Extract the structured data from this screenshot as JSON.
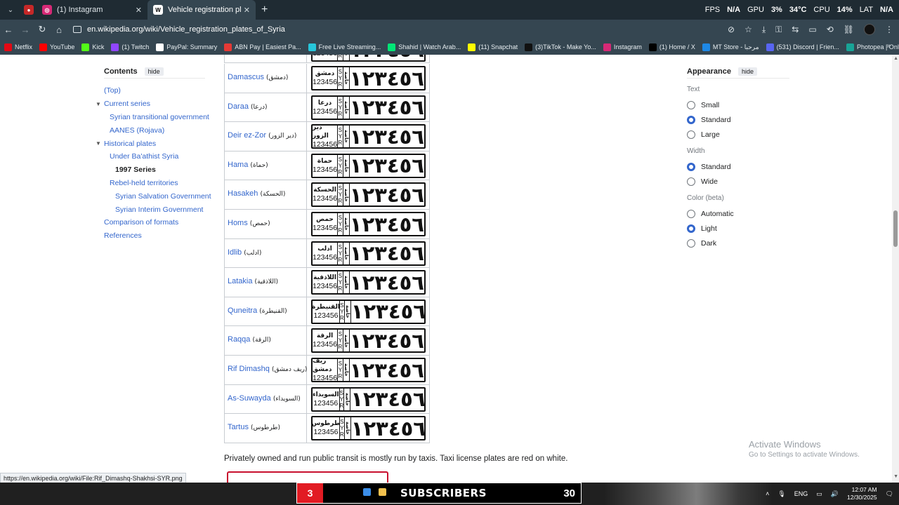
{
  "browser": {
    "tabs": [
      {
        "title": "",
        "favicon": "red-app-icon",
        "color": "#c62828"
      },
      {
        "title": "(1) Instagram",
        "favicon": "instagram-icon",
        "color": "#d62976"
      },
      {
        "title": "Vehicle registration plates of Syria",
        "favicon": "wikipedia-icon",
        "color": "#ffffff"
      }
    ],
    "perf": {
      "fps_label": "FPS",
      "fps": "N/A",
      "gpu_label": "GPU",
      "gpu": "3%",
      "gpu_temp": "34°C",
      "cpu_label": "CPU",
      "cpu": "14%",
      "lat_label": "LAT",
      "lat": "N/A"
    },
    "url": "en.wikipedia.org/wiki/Vehicle_registration_plates_of_Syria",
    "bookmarks": [
      {
        "label": "Netflix",
        "color": "#e50914"
      },
      {
        "label": "YouTube",
        "color": "#ff0000"
      },
      {
        "label": "Kick",
        "color": "#53fc18"
      },
      {
        "label": "(1) Twitch",
        "color": "#9146ff"
      },
      {
        "label": "PayPal: Summary",
        "color": "#ffffff"
      },
      {
        "label": "ABN Pay | Easiest Pa...",
        "color": "#e53935"
      },
      {
        "label": "Free Live Streaming...",
        "color": "#26c6da"
      },
      {
        "label": "Shahid | Watch Arab...",
        "color": "#00e676"
      },
      {
        "label": "(11) Snapchat",
        "color": "#fffc00"
      },
      {
        "label": "(3)TikTok - Make Yo...",
        "color": "#111111"
      },
      {
        "label": "Instagram",
        "color": "#d62976"
      },
      {
        "label": "(1) Home / X",
        "color": "#000000"
      },
      {
        "label": "MT Store - مرحبا",
        "color": "#1e88e5"
      },
      {
        "label": "(531) Discord | Frien...",
        "color": "#5865f2"
      },
      {
        "label": "Photopea | Online P...",
        "color": "#18a497"
      }
    ]
  },
  "toc": {
    "title": "Contents",
    "hide": "hide",
    "items": [
      {
        "label": "(Top)",
        "indent": 0
      },
      {
        "label": "Current series",
        "indent": 0,
        "chevron": true
      },
      {
        "label": "Syrian transitional government",
        "indent": 1
      },
      {
        "label": "AANES (Rojava)",
        "indent": 1
      },
      {
        "label": "Historical plates",
        "indent": 0,
        "chevron": true
      },
      {
        "label": "Under Ba'athist Syria",
        "indent": 1
      },
      {
        "label": "1997 Series",
        "indent": 2,
        "current": true
      },
      {
        "label": "Rebel-held territories",
        "indent": 1
      },
      {
        "label": "Syrian Salvation Government",
        "indent": 2
      },
      {
        "label": "Syrian Interim Government",
        "indent": 2
      },
      {
        "label": "Comparison of formats",
        "indent": 0
      },
      {
        "label": "References",
        "indent": 0
      }
    ]
  },
  "plates": {
    "digits_latin": "123456",
    "digits_arabic": "١٢٣٤٥٦",
    "syr": [
      "S",
      "Y",
      "R"
    ],
    "side_text": "خاصة",
    "rows": [
      {
        "city": "Damascus",
        "arabic": "(دمشق)",
        "gov": "دمشق"
      },
      {
        "city": "Daraa",
        "arabic": "(درعا)",
        "gov": "درعا"
      },
      {
        "city": "Deir ez-Zor",
        "arabic": "(دير الزور)",
        "gov": "دير الزور"
      },
      {
        "city": "Hama",
        "arabic": "(حماة)",
        "gov": "حماة"
      },
      {
        "city": "Hasakeh",
        "arabic": "(الحسكة)",
        "gov": "الحسكة"
      },
      {
        "city": "Homs",
        "arabic": "(حمص)",
        "gov": "حمص"
      },
      {
        "city": "Idlib",
        "arabic": "(ادلب)",
        "gov": "ادلب"
      },
      {
        "city": "Latakia",
        "arabic": "(اللاذقية)",
        "gov": "اللاذقية"
      },
      {
        "city": "Quneitra",
        "arabic": "(القنيطرة)",
        "gov": "القنيطرة"
      },
      {
        "city": "Raqqa",
        "arabic": "(الرقة)",
        "gov": "الرقة"
      },
      {
        "city": "Rif Dimashq",
        "arabic": "(ريف دمشق)",
        "gov": "ريف دمشق"
      },
      {
        "city": "As-Suwayda",
        "arabic": "(السويداء)",
        "gov": "السويداء"
      },
      {
        "city": "Tartus",
        "arabic": "(طرطوس)",
        "gov": "طرطوس"
      }
    ]
  },
  "body_text": "Privately owned and run public transit is mostly run by taxis. Taxi license plates are red on white.",
  "appearance": {
    "title": "Appearance",
    "hide": "hide",
    "groups": [
      {
        "label": "Text",
        "options": [
          {
            "label": "Small",
            "on": false
          },
          {
            "label": "Standard",
            "on": true
          },
          {
            "label": "Large",
            "on": false
          }
        ]
      },
      {
        "label": "Width",
        "options": [
          {
            "label": "Standard",
            "on": true
          },
          {
            "label": "Wide",
            "on": false
          }
        ]
      },
      {
        "label": "Color (beta)",
        "options": [
          {
            "label": "Automatic",
            "on": false
          },
          {
            "label": "Light",
            "on": true
          },
          {
            "label": "Dark",
            "on": false
          }
        ]
      }
    ]
  },
  "activate": {
    "line1": "Activate Windows",
    "line2": "Go to Settings to activate Windows."
  },
  "status_url": "https://en.wikipedia.org/wiki/File:Rif_Dimashq-Shakhsi-SYR.png",
  "taskbar": {
    "sub_number": "3",
    "sub_label": "SUBSCRIBERS",
    "sub_count": "30",
    "lang": "ENG",
    "time": "12:07 AM",
    "date": "12/30/2025"
  }
}
